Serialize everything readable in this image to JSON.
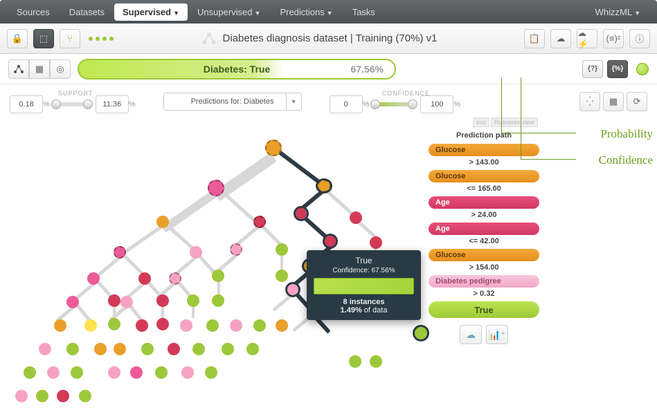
{
  "nav": {
    "sources": "Sources",
    "datasets": "Datasets",
    "supervised": "Supervised",
    "unsupervised": "Unsupervised",
    "predictions": "Predictions",
    "tasks": "Tasks",
    "user": "WhizzML"
  },
  "header": {
    "title": "Diabetes diagnosis dataset | Training (70%) v1"
  },
  "pred": {
    "label": "Diabetes: True",
    "pct": "67.56%"
  },
  "support": {
    "label": "SUPPORT",
    "min": "0.18",
    "max": "11.36"
  },
  "confidence": {
    "label": "CONFIDENCE",
    "min": "0",
    "max": "100"
  },
  "selector": {
    "label": "Predictions for: Diabetes"
  },
  "tooltip": {
    "title": "True",
    "conf": "Confidence: 67.56%",
    "inst": "8 instances",
    "data": "1.49% of data",
    "dataN": "1.49%"
  },
  "path": {
    "title": "Prediction path",
    "steps": [
      {
        "field": "Glucose",
        "op": "> 143.00",
        "cls": "or"
      },
      {
        "field": "Glucose",
        "op": "<= 165.00",
        "cls": "or"
      },
      {
        "field": "Age",
        "op": "> 24.00",
        "cls": "pk"
      },
      {
        "field": "Age",
        "op": "<= 42.00",
        "cls": "pk"
      },
      {
        "field": "Glucose",
        "op": "> 154.00",
        "cls": "or"
      },
      {
        "field": "Diabetes pedigree",
        "op": "> 0.32",
        "cls": "pkL"
      }
    ],
    "final": "True"
  },
  "annotations": {
    "prob": "Probability",
    "conf": "Confidence"
  },
  "hint": {
    "key": "esc",
    "txt": "Releases view"
  }
}
